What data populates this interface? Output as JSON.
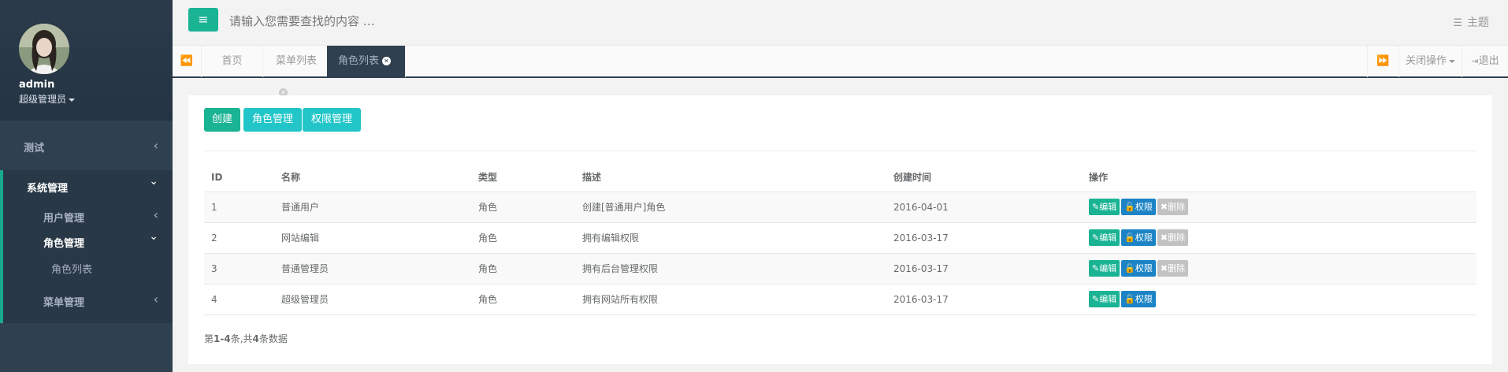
{
  "profile": {
    "name": "admin",
    "role": "超级管理员"
  },
  "sidebar": {
    "items": [
      {
        "label": "测试"
      },
      {
        "label": "系统管理"
      }
    ],
    "sub": [
      {
        "label": "用户管理"
      },
      {
        "label": "角色管理"
      },
      {
        "label": "角色列表"
      },
      {
        "label": "菜单管理"
      }
    ],
    "arrow_left": "‹",
    "arrow_down": "⌄"
  },
  "topbar": {
    "search_placeholder": "请输入您需要查找的内容 …",
    "theme_label": "主题",
    "menu_icon": "≡"
  },
  "tabs": {
    "items": [
      {
        "label": "首页"
      },
      {
        "label": "菜单列表"
      },
      {
        "label": "角色列表"
      }
    ],
    "close_ops": "关闭操作",
    "logout": "退出"
  },
  "toolbar": {
    "create": "创建",
    "role_mgmt": "角色管理",
    "perm_mgmt": "权限管理"
  },
  "table": {
    "headers": [
      "ID",
      "名称",
      "类型",
      "描述",
      "创建时间",
      "操作"
    ],
    "rows": [
      {
        "id": "1",
        "name": "普通用户",
        "type": "角色",
        "desc": "创建[普通用户]角色",
        "created": "2016-04-01"
      },
      {
        "id": "2",
        "name": "网站编辑",
        "type": "角色",
        "desc": "拥有编辑权限",
        "created": "2016-03-17"
      },
      {
        "id": "3",
        "name": "普通管理员",
        "type": "角色",
        "desc": "拥有后台管理权限",
        "created": "2016-03-17"
      },
      {
        "id": "4",
        "name": "超级管理员",
        "type": "角色",
        "desc": "拥有网站所有权限",
        "created": "2016-03-17"
      }
    ],
    "actions": {
      "edit": "编辑",
      "perm": "权限",
      "del": "删除"
    }
  },
  "summary": {
    "prefix": "第",
    "range": "1-4",
    "mid": "条,共",
    "total": "4",
    "suffix": "条数据"
  }
}
